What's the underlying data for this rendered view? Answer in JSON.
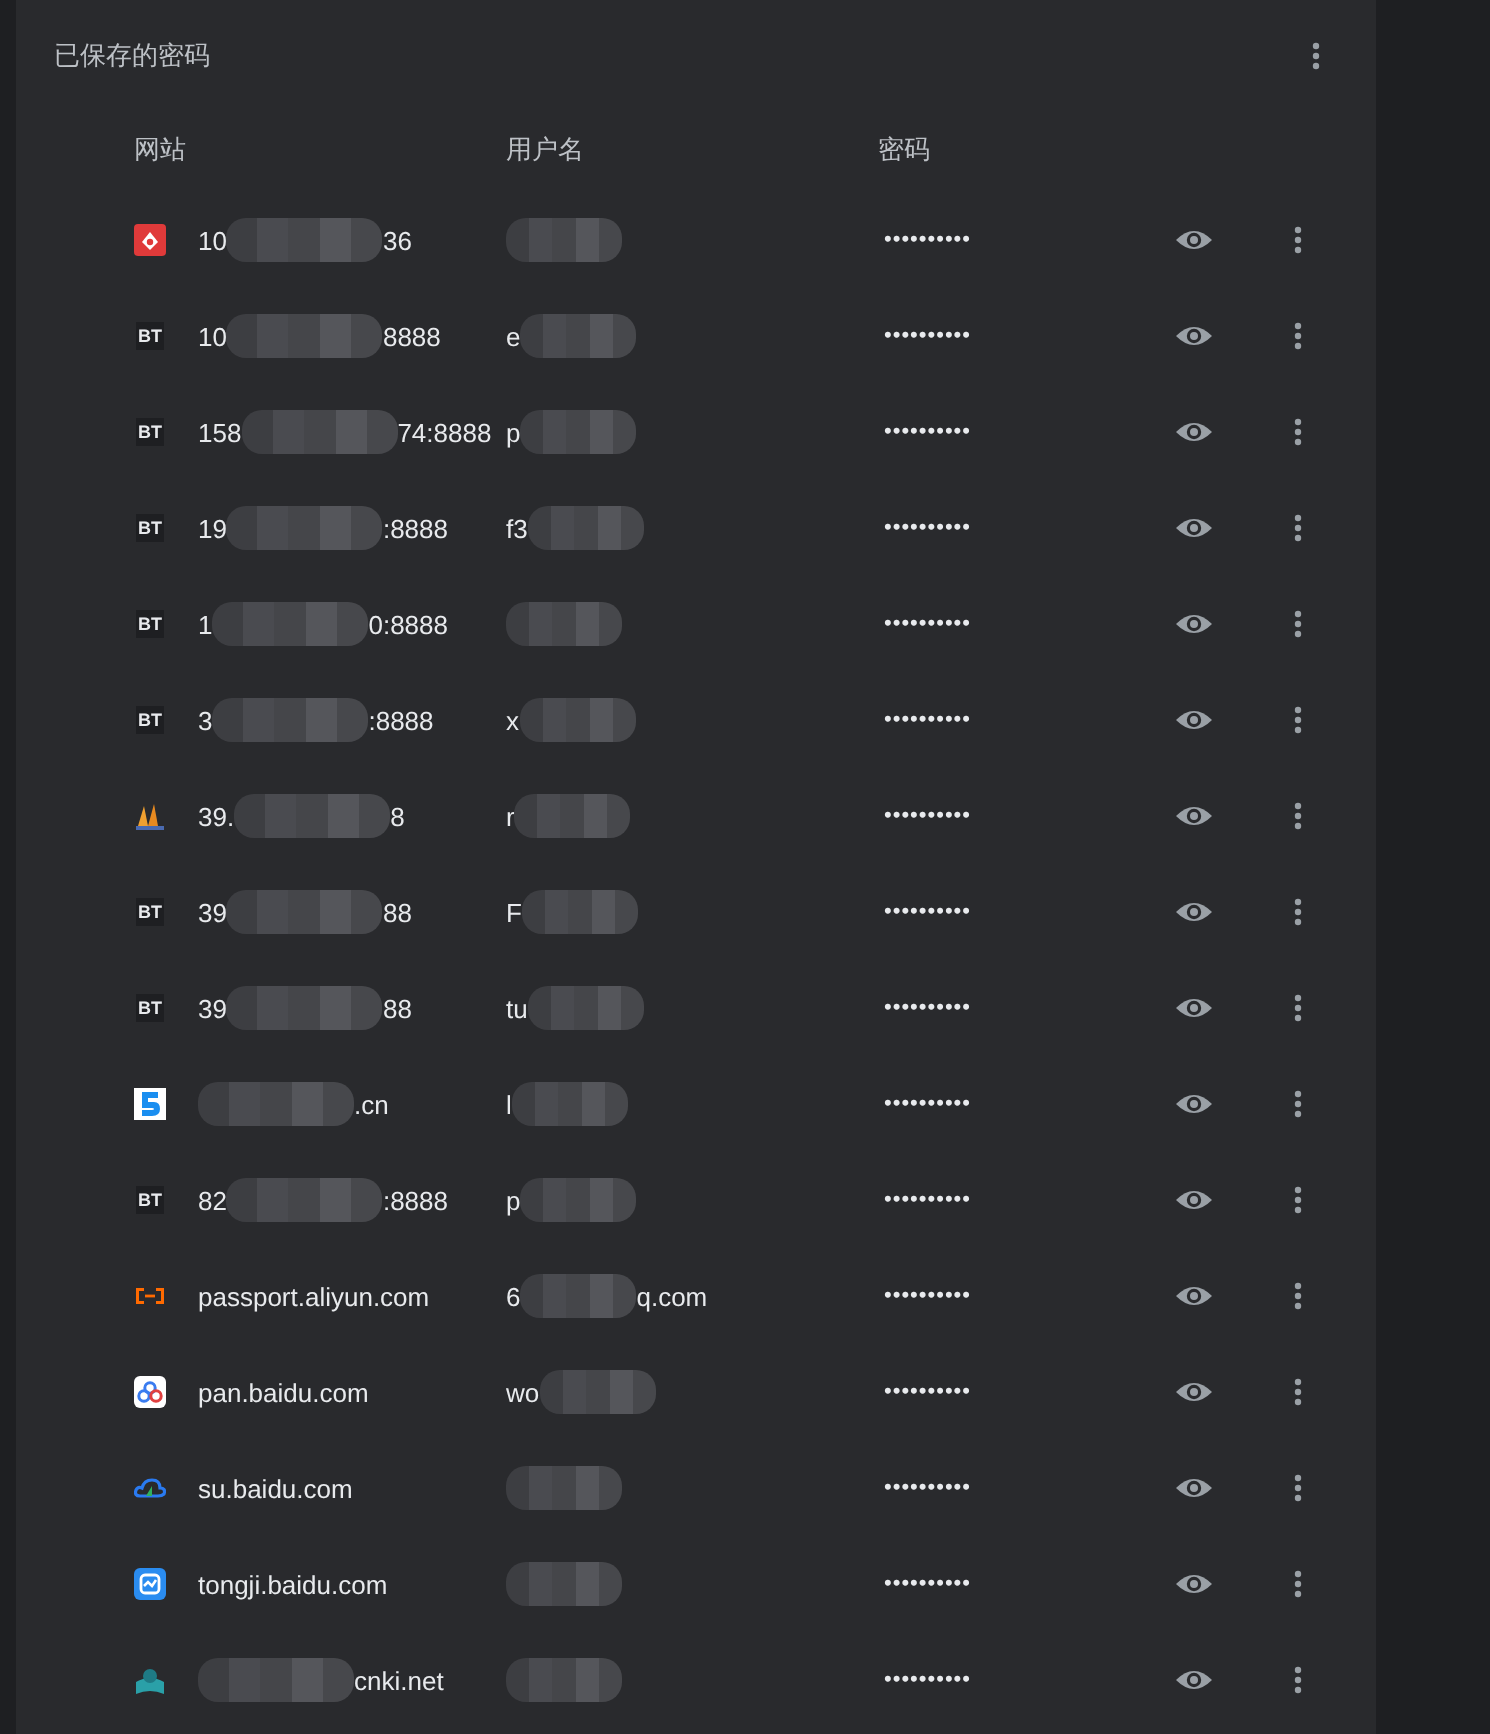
{
  "section": {
    "title": "已保存的密码"
  },
  "columns": [
    "网站",
    "用户名",
    "密码"
  ],
  "rows": [
    {
      "kind": "favicon",
      "site": [
        {
          "kind": "text",
          "text": "10"
        },
        {
          "kind": "redacted"
        },
        {
          "kind": "text",
          "text": "36"
        }
      ],
      "user": [
        {
          "kind": "redacted"
        }
      ],
      "password": "••••••••••"
    },
    {
      "kind": "badge",
      "badge": "BT",
      "site": [
        {
          "kind": "text",
          "text": "10"
        },
        {
          "kind": "redacted"
        },
        {
          "kind": "text",
          "text": "8888"
        }
      ],
      "user": [
        {
          "kind": "text",
          "text": "e"
        },
        {
          "kind": "redacted"
        }
      ],
      "password": "••••••••••"
    },
    {
      "kind": "badge",
      "badge": "BT",
      "site": [
        {
          "kind": "text",
          "text": "158"
        },
        {
          "kind": "redacted"
        },
        {
          "kind": "text",
          "text": "74:8888"
        }
      ],
      "user": [
        {
          "kind": "text",
          "text": "p"
        },
        {
          "kind": "redacted"
        }
      ],
      "password": "••••••••••"
    },
    {
      "kind": "badge",
      "badge": "BT",
      "site": [
        {
          "kind": "text",
          "text": "19"
        },
        {
          "kind": "redacted"
        },
        {
          "kind": "text",
          "text": ":8888"
        }
      ],
      "user": [
        {
          "kind": "text",
          "text": "f3"
        },
        {
          "kind": "redacted"
        }
      ],
      "password": "••••••••••"
    },
    {
      "kind": "badge",
      "badge": "BT",
      "site": [
        {
          "kind": "text",
          "text": "1"
        },
        {
          "kind": "redacted"
        },
        {
          "kind": "text",
          "text": "0:8888"
        }
      ],
      "user": [
        {
          "kind": "redacted"
        }
      ],
      "password": "••••••••••"
    },
    {
      "kind": "badge",
      "badge": "BT",
      "site": [
        {
          "kind": "text",
          "text": "3"
        },
        {
          "kind": "redacted"
        },
        {
          "kind": "text",
          "text": ":8888"
        }
      ],
      "user": [
        {
          "kind": "text",
          "text": "x"
        },
        {
          "kind": "redacted"
        }
      ],
      "password": "••••••••••"
    },
    {
      "kind": "favicon",
      "site": [
        {
          "kind": "text",
          "text": "39."
        },
        {
          "kind": "redacted"
        },
        {
          "kind": "text",
          "text": "8"
        }
      ],
      "user": [
        {
          "kind": "text",
          "text": "r"
        },
        {
          "kind": "redacted"
        }
      ],
      "password": "••••••••••"
    },
    {
      "kind": "badge",
      "badge": "BT",
      "site": [
        {
          "kind": "text",
          "text": "39"
        },
        {
          "kind": "redacted"
        },
        {
          "kind": "text",
          "text": "88"
        }
      ],
      "user": [
        {
          "kind": "text",
          "text": "F"
        },
        {
          "kind": "redacted"
        }
      ],
      "password": "••••••••••"
    },
    {
      "kind": "badge",
      "badge": "BT",
      "site": [
        {
          "kind": "text",
          "text": "39"
        },
        {
          "kind": "redacted"
        },
        {
          "kind": "text",
          "text": "88"
        }
      ],
      "user": [
        {
          "kind": "text",
          "text": "tu"
        },
        {
          "kind": "redacted"
        }
      ],
      "password": "••••••••••"
    },
    {
      "kind": "favicon",
      "site": [
        {
          "kind": "redacted"
        },
        {
          "kind": "text",
          "text": ".cn"
        }
      ],
      "user": [
        {
          "kind": "text",
          "text": "l"
        },
        {
          "kind": "redacted"
        }
      ],
      "password": "••••••••••"
    },
    {
      "kind": "badge",
      "badge": "BT",
      "site": [
        {
          "kind": "text",
          "text": "82"
        },
        {
          "kind": "redacted"
        },
        {
          "kind": "text",
          "text": ":8888"
        }
      ],
      "user": [
        {
          "kind": "text",
          "text": "p"
        },
        {
          "kind": "redacted"
        }
      ],
      "password": "••••••••••"
    },
    {
      "kind": "favicon",
      "site": [
        {
          "kind": "text",
          "text": "passport.aliyun.com"
        }
      ],
      "user": [
        {
          "kind": "text",
          "text": "6"
        },
        {
          "kind": "redacted"
        },
        {
          "kind": "text",
          "text": "q.com"
        }
      ],
      "password": "••••••••••"
    },
    {
      "kind": "favicon",
      "site": [
        {
          "kind": "text",
          "text": "pan.baidu.com"
        }
      ],
      "user": [
        {
          "kind": "text",
          "text": "wo"
        },
        {
          "kind": "redacted"
        }
      ],
      "password": "••••••••••"
    },
    {
      "kind": "favicon",
      "site": [
        {
          "kind": "text",
          "text": "su.baidu.com"
        }
      ],
      "user": [
        {
          "kind": "redacted"
        }
      ],
      "password": "••••••••••"
    },
    {
      "kind": "favicon",
      "site": [
        {
          "kind": "text",
          "text": "tongji.baidu.com"
        }
      ],
      "user": [
        {
          "kind": "redacted"
        }
      ],
      "password": "••••••••••"
    },
    {
      "kind": "favicon",
      "site": [
        {
          "kind": "redacted"
        },
        {
          "kind": "text",
          "text": "cnki.net"
        }
      ],
      "user": [
        {
          "kind": "redacted"
        }
      ],
      "password": "••••••••••"
    }
  ]
}
